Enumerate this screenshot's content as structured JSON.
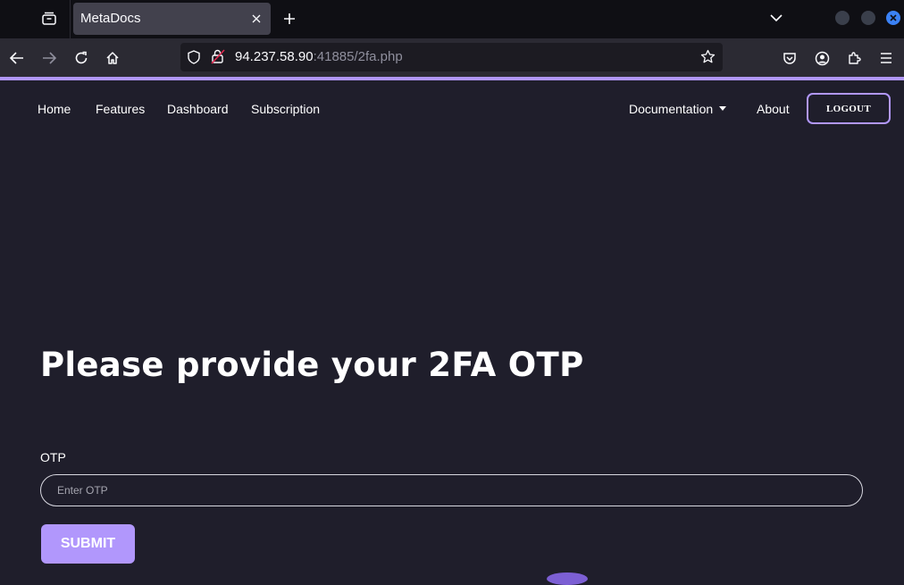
{
  "browser": {
    "tab_title": "MetaDocs",
    "url_host": "94.237.58.90",
    "url_rest": ":41885/2fa.php",
    "accent_color": "#b197fc"
  },
  "nav": {
    "links": [
      "Home",
      "Features",
      "Dashboard",
      "Subscription"
    ],
    "documentation": "Documentation",
    "about": "About",
    "logout": "LOGOUT"
  },
  "main": {
    "heading": "Please provide your 2FA OTP",
    "otp_label": "OTP",
    "otp_placeholder": "Enter OTP",
    "otp_value": "",
    "submit": "SUBMIT"
  }
}
